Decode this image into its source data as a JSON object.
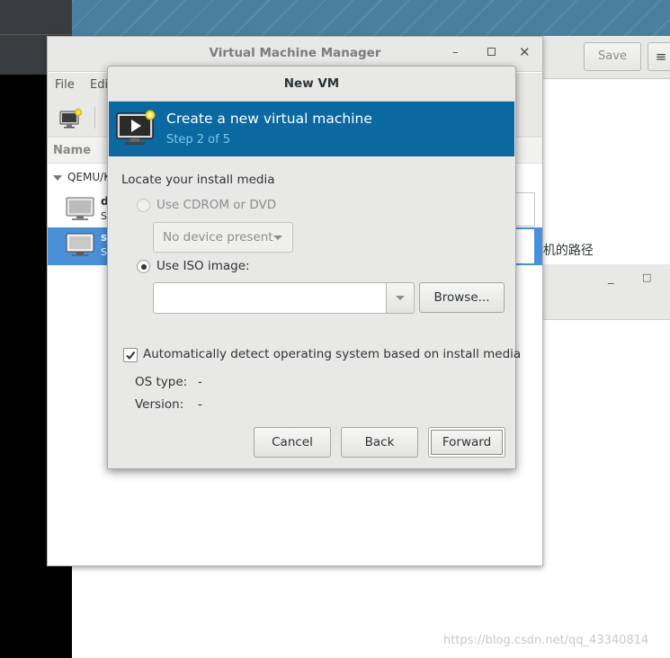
{
  "background": {
    "save_label": "Save",
    "menu_icon": "≡",
    "path_text_fragment": "l机的路径",
    "minimize_icon": "_",
    "maximize_icon": "□",
    "watermark": "https://blog.csdn.net/qq_43340814"
  },
  "vmm": {
    "title": "Virtual Machine Manager",
    "menu": {
      "file": "File",
      "edit": "Edi"
    },
    "column_name": "Name",
    "group": "QEMU/K",
    "rows": [
      {
        "name": "d",
        "state": "S"
      },
      {
        "name": "s",
        "state": "S"
      }
    ]
  },
  "dialog": {
    "title": "New VM",
    "header_title": "Create a new virtual machine",
    "header_step": "Step 2 of 5",
    "section_label": "Locate your install media",
    "option_cdrom": "Use CDROM or DVD",
    "cdrom_device": "No device present",
    "option_iso": "Use ISO image:",
    "iso_path": "",
    "browse_label": "Browse...",
    "auto_detect_label": "Automatically detect operating system based on install media",
    "os_type_label": "OS type:",
    "os_type_value": "-",
    "version_label": "Version:",
    "version_value": "-",
    "cancel_label": "Cancel",
    "back_label": "Back",
    "forward_label": "Forward",
    "selected_option": "iso",
    "auto_detect_checked": true
  },
  "colors": {
    "banner": "#0b68a0",
    "step_text": "#7ac8f0",
    "selection": "#4a90d9"
  }
}
